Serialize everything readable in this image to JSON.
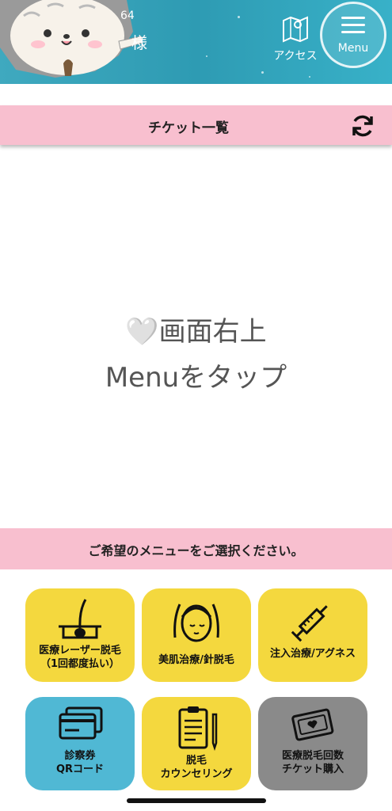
{
  "header": {
    "member_id_fragment": "64",
    "member_suffix": "様",
    "access_label": "アクセス",
    "menu_label": "Menu"
  },
  "ticket_bar": {
    "title": "チケット一覧"
  },
  "center_message": {
    "line1": "画面右上",
    "line2": "Menuをタップ",
    "heart": "🤍"
  },
  "selection_banner": {
    "text": "ご希望のメニューをご選択ください。"
  },
  "tiles": [
    {
      "label": "医療レーザー脱毛\n（1回都度払い）",
      "icon": "hair-follicle-icon",
      "color": "#f4d83e"
    },
    {
      "label": "美肌治療/針脱毛",
      "icon": "face-care-icon",
      "color": "#f4d83e"
    },
    {
      "label": "注入治療/アグネス",
      "icon": "syringe-icon",
      "color": "#f4d83e"
    },
    {
      "label": "診察券\nQRコード",
      "icon": "card-icon",
      "color": "#50b8d4"
    },
    {
      "label": "脱毛\nカウンセリング",
      "icon": "clipboard-icon",
      "color": "#f4d83e"
    },
    {
      "label": "医療脱毛回数\nチケット購入",
      "icon": "ticket-icon",
      "color": "#8a8a8a"
    }
  ]
}
